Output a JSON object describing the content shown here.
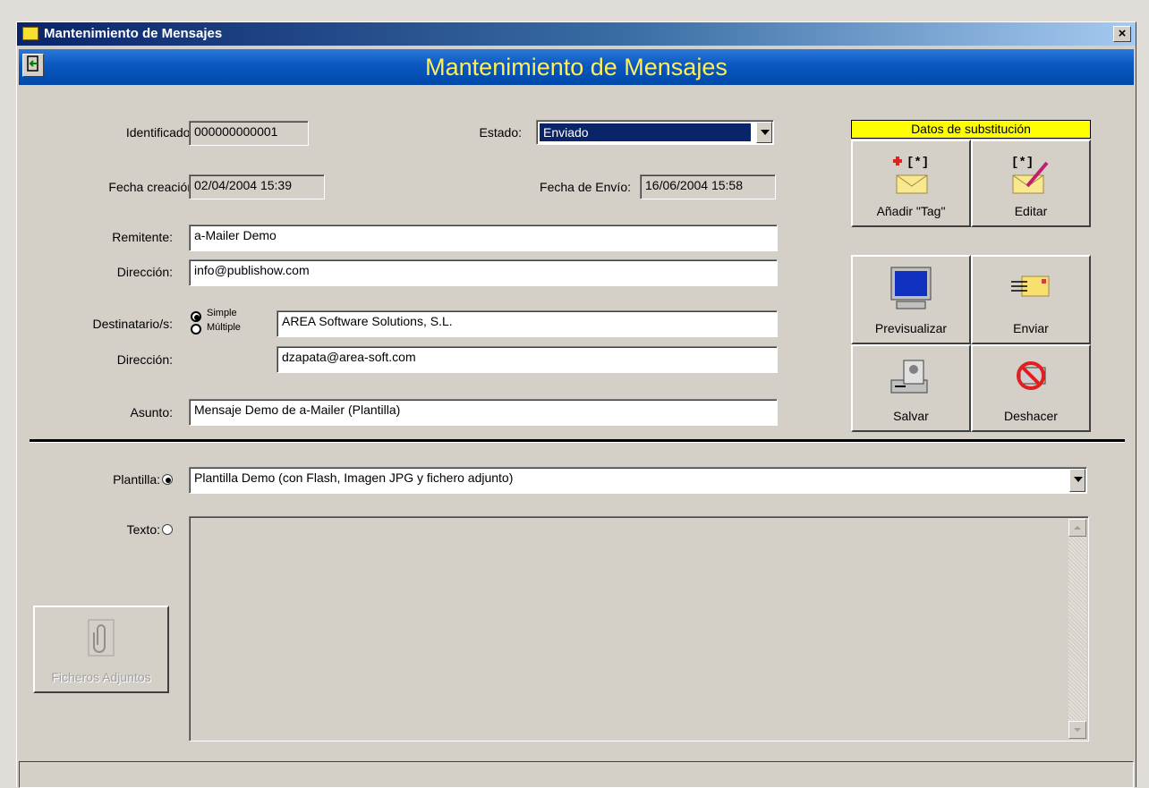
{
  "window": {
    "title": "Mantenimiento de Mensajes",
    "close_label": "×"
  },
  "banner": {
    "title": "Mantenimiento de Mensajes"
  },
  "form": {
    "identificador": {
      "label": "Identificador:",
      "value": "000000000001"
    },
    "estado": {
      "label": "Estado:",
      "value": "Enviado"
    },
    "fecha_creacion": {
      "label": "Fecha creación:",
      "value": "02/04/2004 15:39"
    },
    "fecha_envio": {
      "label": "Fecha de Envío:",
      "value": "16/06/2004 15:58"
    },
    "remitente": {
      "label": "Remitente:",
      "value": "a-Mailer Demo"
    },
    "direccion_remitente": {
      "label": "Dirección:",
      "value": "info@publishow.com"
    },
    "destinatario": {
      "label": "Destinatario/s:",
      "option_simple": "Simple",
      "option_multiple": "Múltiple",
      "selected": "Simple",
      "value": "AREA Software Solutions, S.L."
    },
    "direccion_destinatario": {
      "label": "Dirección:",
      "value": "dzapata@area-soft.com"
    },
    "asunto": {
      "label": "Asunto:",
      "value": "Mensaje Demo de a-Mailer (Plantilla)"
    }
  },
  "substitution": {
    "header": "Datos de substitución",
    "add_tag_label": "Añadir \"Tag\"",
    "edit_label": "Editar"
  },
  "actions": {
    "preview_label": "Previsualizar",
    "send_label": "Enviar",
    "save_label": "Salvar",
    "undo_label": "Deshacer"
  },
  "body": {
    "plantilla_label": "Plantilla:",
    "plantilla_value": "Plantilla Demo (con Flash, Imagen JPG y fichero adjunto)",
    "texto_label": "Texto:",
    "texto_value": "",
    "selected": "Plantilla",
    "attachments_label": "Ficheros Adjuntos"
  },
  "colors": {
    "banner": "#0a58c0",
    "banner_text": "#ffee58",
    "selection": "#0a246a",
    "highlight": "#ffff00"
  }
}
